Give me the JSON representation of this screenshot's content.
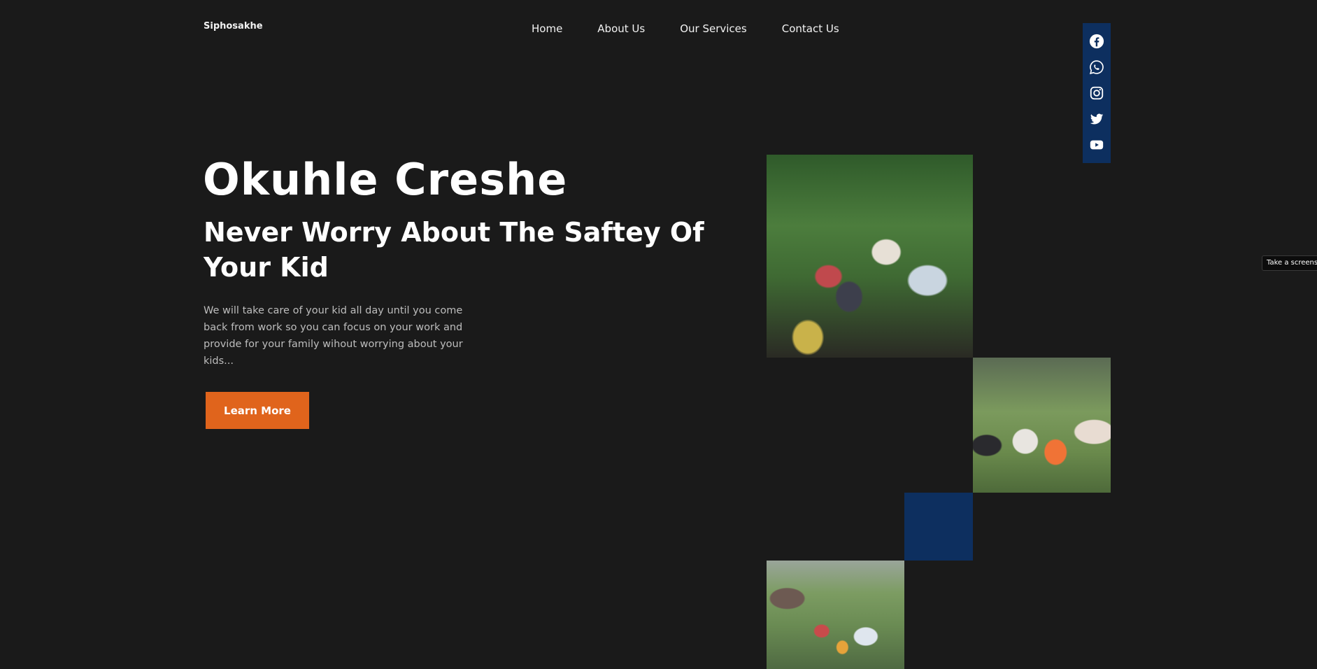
{
  "brand": {
    "name": "Siphosakhe"
  },
  "nav": {
    "items": [
      {
        "label": "Home"
      },
      {
        "label": "About Us"
      },
      {
        "label": "Our Services"
      },
      {
        "label": "Contact Us"
      }
    ]
  },
  "social": {
    "icons": [
      "facebook-icon",
      "whatsapp-icon",
      "instagram-icon",
      "twitter-icon",
      "youtube-icon"
    ]
  },
  "hero": {
    "title": "Okuhle Creshe",
    "subtitle": "Never Worry About The Saftey Of Your Kid",
    "text": "We will take care of your kid all day until you come back from work so you can focus on your work and provide for your family wihout worrying about your kids...",
    "cta_label": "Learn More"
  },
  "tooltip": {
    "text": "Take a screens"
  },
  "colors": {
    "background": "#1a1a1a",
    "accent": "#e0641c",
    "navy": "#0d2f5f"
  }
}
